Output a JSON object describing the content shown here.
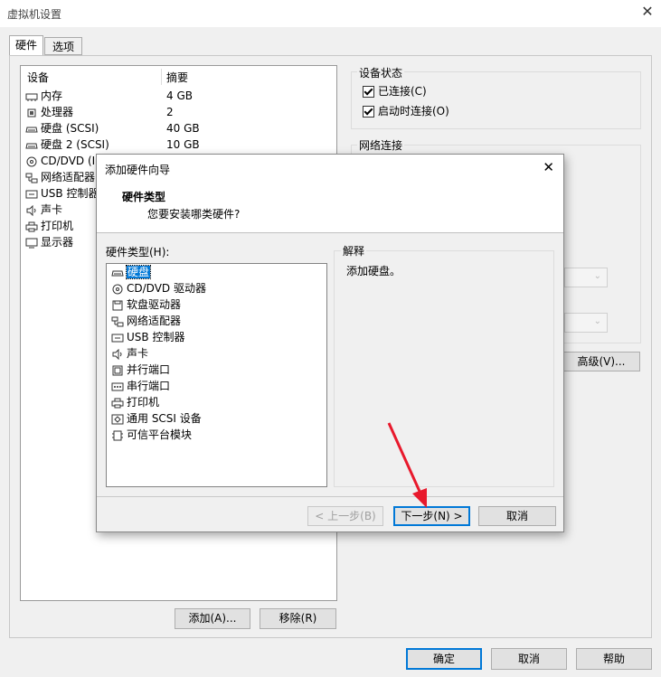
{
  "window": {
    "title": "虚拟机设置",
    "close": "✕"
  },
  "tabs": [
    {
      "label": "硬件"
    },
    {
      "label": "选项"
    }
  ],
  "device_table": {
    "headers": [
      "设备",
      "摘要"
    ],
    "rows": [
      {
        "icon": "memory-icon",
        "name": "内存",
        "summary": "4 GB"
      },
      {
        "icon": "cpu-icon",
        "name": "处理器",
        "summary": "2"
      },
      {
        "icon": "disk-icon",
        "name": "硬盘 (SCSI)",
        "summary": "40 GB"
      },
      {
        "icon": "disk-icon",
        "name": "硬盘 2 (SCSI)",
        "summary": "10 GB"
      },
      {
        "icon": "cd-icon",
        "name": "CD/DVD (II",
        "summary": ""
      },
      {
        "icon": "network-icon",
        "name": "网络适配器",
        "summary": ""
      },
      {
        "icon": "usb-icon",
        "name": "USB 控制器",
        "summary": ""
      },
      {
        "icon": "speaker-icon",
        "name": "声卡",
        "summary": ""
      },
      {
        "icon": "printer-icon",
        "name": "打印机",
        "summary": ""
      },
      {
        "icon": "monitor-icon",
        "name": "显示器",
        "summary": ""
      }
    ]
  },
  "buttons": {
    "add": "添加(A)...",
    "remove": "移除(R)",
    "ok": "确定",
    "cancel": "取消",
    "help": "帮助",
    "advanced": "高级(V)..."
  },
  "device_status": {
    "title": "设备状态",
    "connected": "已连接(C)",
    "connect_on_start": "启动时连接(O)"
  },
  "network": {
    "title": "网络连接"
  },
  "wizard": {
    "title": "添加硬件向导",
    "close": "✕",
    "heading": "硬件类型",
    "subheading": "您要安装哪类硬件?",
    "list_label": "硬件类型(H):",
    "items": [
      {
        "icon": "disk-icon",
        "label": "硬盘",
        "selected": true
      },
      {
        "icon": "cd-icon",
        "label": "CD/DVD 驱动器"
      },
      {
        "icon": "floppy-icon",
        "label": "软盘驱动器"
      },
      {
        "icon": "network-icon",
        "label": "网络适配器"
      },
      {
        "icon": "usb-icon",
        "label": "USB 控制器"
      },
      {
        "icon": "speaker-icon",
        "label": "声卡"
      },
      {
        "icon": "parallel-port-icon",
        "label": "并行端口"
      },
      {
        "icon": "serial-port-icon",
        "label": "串行端口"
      },
      {
        "icon": "printer-icon",
        "label": "打印机"
      },
      {
        "icon": "scsi-icon",
        "label": "通用 SCSI 设备"
      },
      {
        "icon": "tpm-icon",
        "label": "可信平台模块"
      }
    ],
    "explain_title": "解释",
    "explain_text": "添加硬盘。",
    "back": "< 上一步(B)",
    "next": "下一步(N) >",
    "cancel": "取消"
  },
  "colors": {
    "accent": "#0078d7",
    "arrow": "#e8192c"
  }
}
